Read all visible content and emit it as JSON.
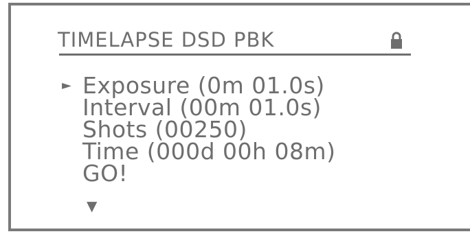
{
  "header": {
    "title": "TIMELAPSE DSD PBK",
    "lock_icon": "lock-icon"
  },
  "menu": {
    "cursor_glyph": "►",
    "more_glyph": "▼",
    "items": [
      {
        "label": "Exposure (0m 01.0s)"
      },
      {
        "label": "Interval (00m 01.0s)"
      },
      {
        "label": "Shots (00250)"
      },
      {
        "label": "Time (000d 00h 08m)"
      },
      {
        "label": "GO!"
      }
    ]
  },
  "colors": {
    "text": "#6e6e6e",
    "border": "#7a7a7a",
    "background": "#ffffff"
  }
}
